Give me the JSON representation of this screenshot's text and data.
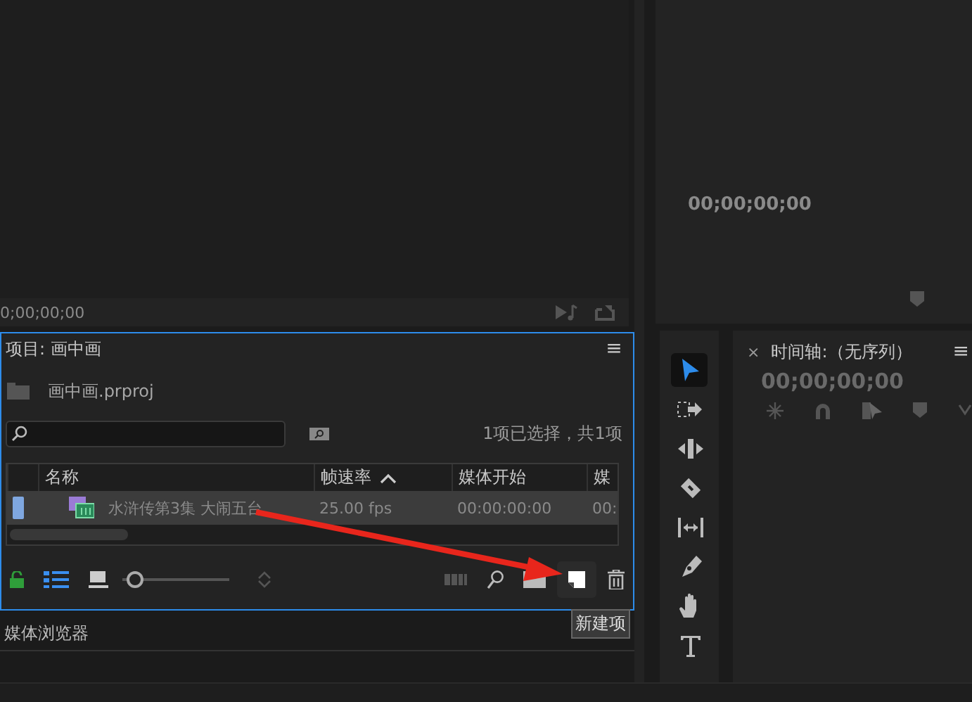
{
  "source_monitor": {
    "timecode": "0;00;00;00"
  },
  "program_monitor": {
    "timecode": "00;00;00;00"
  },
  "project_panel": {
    "title": "项目: 画中画",
    "menu": "≡",
    "project_file": "画中画.prproj",
    "selection_status": "1项已选择，共1项",
    "columns": [
      {
        "label": "名称",
        "sorted": false
      },
      {
        "label": "帧速率",
        "sorted": true
      },
      {
        "label": "媒体开始",
        "sorted": false
      },
      {
        "label": "媒",
        "sorted": false
      }
    ],
    "rows": [
      {
        "selected": true,
        "cells": [
          "水浒传第3集 大闹五台",
          "25.00 fps",
          "00:00:00:00",
          "00:"
        ]
      }
    ],
    "zoom_slider": {
      "level": 0.05
    },
    "tooltip": "新建项"
  },
  "media_browser_tab": "媒体浏览器",
  "tools": [
    {
      "kind": "selection",
      "selected": true
    },
    {
      "kind": "track-select",
      "selected": false
    },
    {
      "kind": "ripple",
      "selected": false
    },
    {
      "kind": "razor",
      "selected": false
    },
    {
      "kind": "slip",
      "selected": false
    },
    {
      "kind": "pen",
      "selected": false
    },
    {
      "kind": "hand",
      "selected": false
    },
    {
      "kind": "type",
      "selected": false
    }
  ],
  "timeline": {
    "close": "×",
    "title": "时间轴:（无序列）",
    "menu": "≡",
    "timecode": "00;00;00;00"
  }
}
